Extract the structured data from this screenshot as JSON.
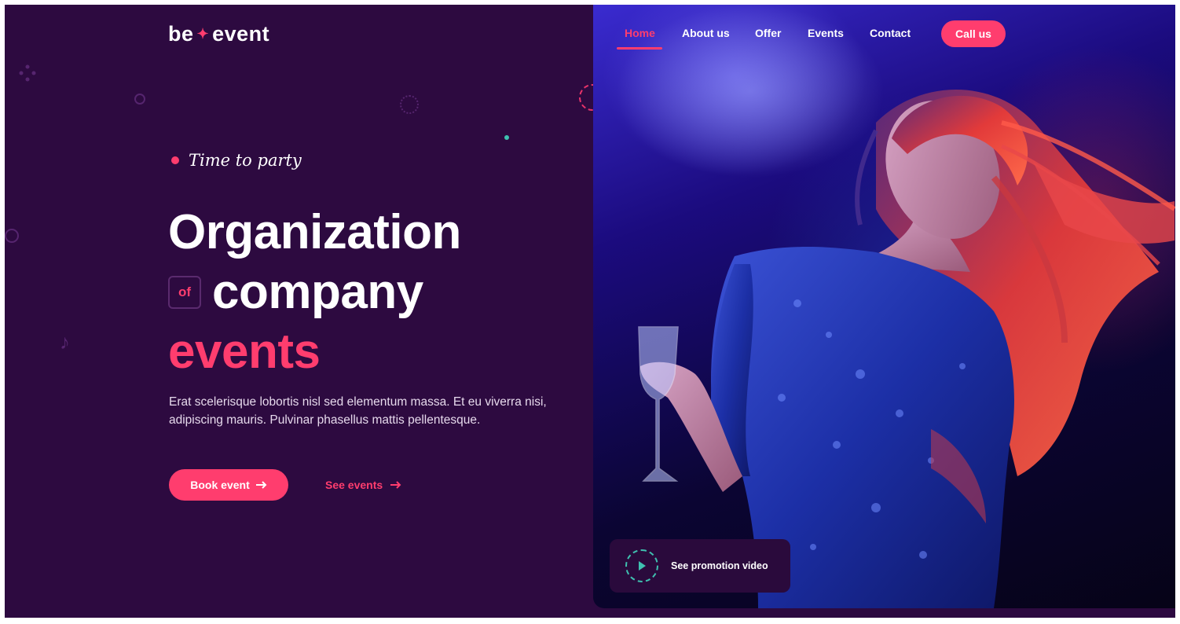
{
  "logo": {
    "left": "be",
    "right": "event"
  },
  "nav": {
    "items": [
      {
        "label": "Home",
        "active": true
      },
      {
        "label": "About us",
        "active": false
      },
      {
        "label": "Offer",
        "active": false
      },
      {
        "label": "Events",
        "active": false
      },
      {
        "label": "Contact",
        "active": false
      }
    ],
    "cta_label": "Call us"
  },
  "hero": {
    "tagline": "Time to party",
    "title_line1": "Organization",
    "title_of": "of",
    "title_line2": "company",
    "title_line3": "events",
    "description": "Erat scelerisque lobortis nisl sed elementum massa. Et eu viverra nisi, adipiscing mauris. Pulvinar phasellus mattis pellentesque.",
    "primary_button": "Book event",
    "secondary_link": "See events",
    "promo_label": "See promotion video"
  },
  "colors": {
    "background": "#2d0a40",
    "accent": "#ff3d6e",
    "teal": "#3fc1b0",
    "text": "#ffffff"
  },
  "icons": {
    "logo_mark": "sparkle-icon",
    "primary_button": "arrow-right-icon",
    "secondary_link": "arrow-right-icon",
    "promo": "play-icon"
  }
}
